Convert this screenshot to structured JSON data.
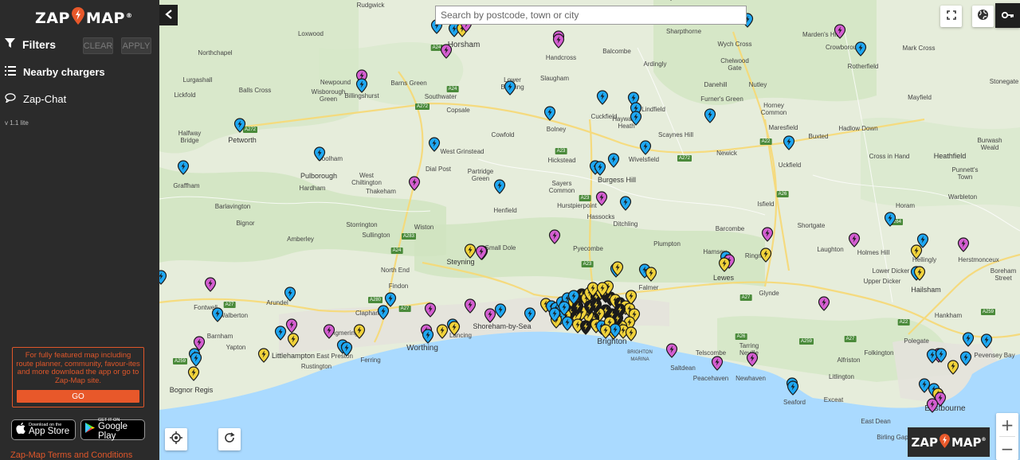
{
  "sidebar": {
    "logo_left": "ZAP",
    "logo_right": "MAP",
    "logo_reg": "®",
    "filters_label": "Filters",
    "clear_label": "CLEAR",
    "apply_label": "APPLY",
    "nearby_label": "Nearby chargers",
    "chat_label": "Zap-Chat",
    "version": "v 1.1 lite",
    "promo_text": "For fully featured map including route planner, community, favour-ites and more download the app or go to Zap-Map site.",
    "go_label": "GO",
    "app_store_small": "Download on the",
    "app_store_big": "App Store",
    "google_play_small": "GET IT ON",
    "google_play_big": "Google Play",
    "terms": "Zap-Map Terms and Conditions"
  },
  "search": {
    "placeholder": "Search by postcode, town or city"
  },
  "map_logo": {
    "left": "ZAP",
    "right": "MAP",
    "reg": "®"
  },
  "zoom": {
    "in": "+",
    "out": "−"
  },
  "colors": {
    "accent": "#e8582a",
    "sidebar": "#2b2b2b",
    "sea": "#aadaff",
    "pin_blue": "#1ea7f2",
    "pin_pink": "#d45ed1",
    "pin_yellow": "#f0d23a",
    "pin_black": "#1b1b1b"
  },
  "places": [
    {
      "name": "Rudgwick"
    },
    {
      "name": "Loxwood"
    },
    {
      "name": "Northchapel"
    },
    {
      "name": "Lurgashall"
    },
    {
      "name": "Balls Cross"
    },
    {
      "name": "Lickfold"
    },
    {
      "name": "Newpound"
    },
    {
      "name": "Wisborough\nGreen"
    },
    {
      "name": "Billingshurst"
    },
    {
      "name": "Halfway\nBridge"
    },
    {
      "name": "Petworth"
    },
    {
      "name": "Coolham"
    },
    {
      "name": "Pulborough"
    },
    {
      "name": "Graffham"
    },
    {
      "name": "Hardham"
    },
    {
      "name": "West\nChiltington"
    },
    {
      "name": "Thakeham"
    },
    {
      "name": "Barlavington"
    },
    {
      "name": "Bignor"
    },
    {
      "name": "Storrington"
    },
    {
      "name": "Sullington"
    },
    {
      "name": "Amberley"
    },
    {
      "name": "Fontwell"
    },
    {
      "name": "Walberton"
    },
    {
      "name": "Arundel"
    },
    {
      "name": "Barnham"
    },
    {
      "name": "Yapton"
    },
    {
      "name": "Littlehampton"
    },
    {
      "name": "Rustington"
    },
    {
      "name": "East Preston"
    },
    {
      "name": "Ferring"
    },
    {
      "name": "Angmering"
    },
    {
      "name": "Bognor Regis"
    },
    {
      "name": "Horsham"
    },
    {
      "name": "Barns Green"
    },
    {
      "name": "Southwater"
    },
    {
      "name": "Copsale"
    },
    {
      "name": "West Grinstead"
    },
    {
      "name": "Dial Post"
    },
    {
      "name": "Partridge\nGreen"
    },
    {
      "name": "Cowfold"
    },
    {
      "name": "Henfield"
    },
    {
      "name": "Wiston"
    },
    {
      "name": "Small Dole"
    },
    {
      "name": "Steyning"
    },
    {
      "name": "North End"
    },
    {
      "name": "Findon"
    },
    {
      "name": "Clapham"
    },
    {
      "name": "Worthing"
    },
    {
      "name": "Lancing"
    },
    {
      "name": "Shoreham-by-Sea"
    },
    {
      "name": "Handcross"
    },
    {
      "name": "Lower\nBeeding"
    },
    {
      "name": "Slaugham"
    },
    {
      "name": "Bolney"
    },
    {
      "name": "Balcombe"
    },
    {
      "name": "Ardingly"
    },
    {
      "name": "Cuckfield"
    },
    {
      "name": "Haywards\nHeath"
    },
    {
      "name": "Lindfield"
    },
    {
      "name": "Hickstead"
    },
    {
      "name": "Sayers\nCommon"
    },
    {
      "name": "Burgess Hill"
    },
    {
      "name": "Hurstpierpoint"
    },
    {
      "name": "Hassocks"
    },
    {
      "name": "Ditchling"
    },
    {
      "name": "Pyecombe"
    },
    {
      "name": "Brighton"
    },
    {
      "name": "BRIGHTON\nMARINA"
    },
    {
      "name": "Falmer"
    },
    {
      "name": "Plumpton"
    },
    {
      "name": "Scaynes Hill"
    },
    {
      "name": "Wivelsfield"
    },
    {
      "name": "Sharpthorne"
    },
    {
      "name": "Wych Cross"
    },
    {
      "name": "Chelwood\nGate"
    },
    {
      "name": "Danehill"
    },
    {
      "name": "Nutley"
    },
    {
      "name": "Furner's Green"
    },
    {
      "name": "Horney\nCommon"
    },
    {
      "name": "Maresfield"
    },
    {
      "name": "Newick"
    },
    {
      "name": "Uckfield"
    },
    {
      "name": "Isfield"
    },
    {
      "name": "Barcombe"
    },
    {
      "name": "Hamsey"
    },
    {
      "name": "Ringmer"
    },
    {
      "name": "Lewes"
    },
    {
      "name": "Glynde"
    },
    {
      "name": "Tarring\nNeville"
    },
    {
      "name": "Telscombe"
    },
    {
      "name": "Saltdean"
    },
    {
      "name": "Peacehaven"
    },
    {
      "name": "Newhaven"
    },
    {
      "name": "Seaford"
    },
    {
      "name": "Alfriston"
    },
    {
      "name": "Litlington"
    },
    {
      "name": "Exceat"
    },
    {
      "name": "East Dean"
    },
    {
      "name": "Birling Gap"
    },
    {
      "name": "Marden's Hill"
    },
    {
      "name": "Crowborough"
    },
    {
      "name": "Rotherfield"
    },
    {
      "name": "Mark Cross"
    },
    {
      "name": "Stonegate"
    },
    {
      "name": "Mayfield"
    },
    {
      "name": "Hadlow Down"
    },
    {
      "name": "Buxted"
    },
    {
      "name": "Cross in Hand"
    },
    {
      "name": "Heathfield"
    },
    {
      "name": "Punnett's\nTown"
    },
    {
      "name": "Warbleton"
    },
    {
      "name": "Horam"
    },
    {
      "name": "Laughton"
    },
    {
      "name": "Holmes Hill"
    },
    {
      "name": "Shortgate"
    },
    {
      "name": "Hellingly"
    },
    {
      "name": "Lower Dicker"
    },
    {
      "name": "Upper Dicker"
    },
    {
      "name": "Herstmonceux"
    },
    {
      "name": "Boreham\nStreet"
    },
    {
      "name": "Hailsham"
    },
    {
      "name": "Hankham"
    },
    {
      "name": "Polegate"
    },
    {
      "name": "Folkington"
    },
    {
      "name": "Eastbourne"
    },
    {
      "name": "Pevensey Bay"
    },
    {
      "name": "Burwash\nWeald"
    }
  ],
  "roads": [
    "A272",
    "A24",
    "A272",
    "A283",
    "A24",
    "A27",
    "A280",
    "A27",
    "A259",
    "A23",
    "A23",
    "A23",
    "A272",
    "A26",
    "A22",
    "A27",
    "A26",
    "A259",
    "A22",
    "A27",
    "A259",
    "A264",
    "A24"
  ]
}
